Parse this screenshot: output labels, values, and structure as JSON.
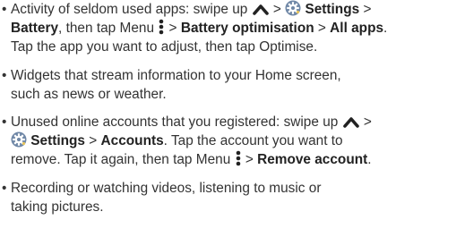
{
  "tips": [
    {
      "lines": [
        [
          "Activity of seldom used apps: swipe up ",
          {
            "icon": "chevron-up-icon"
          },
          " > ",
          {
            "icon": "settings-gear-icon"
          },
          " ",
          {
            "b": "Settings"
          },
          " >"
        ],
        [
          {
            "b": "Battery"
          },
          ", then tap Menu ",
          {
            "icon": "menu-dots-icon"
          },
          " > ",
          {
            "b": "Battery optimisation"
          },
          " > ",
          {
            "b": "All apps"
          },
          "."
        ],
        [
          "Tap the app you want to adjust, then tap Optimise."
        ]
      ]
    },
    {
      "lines": [
        [
          "Widgets that stream information to your Home screen,"
        ],
        [
          "such as news or weather."
        ]
      ]
    },
    {
      "lines": [
        [
          "Unused online accounts that you registered: swipe up ",
          {
            "icon": "chevron-up-icon"
          },
          " >"
        ],
        [
          {
            "icon": "settings-gear-icon"
          },
          " ",
          {
            "b": "Settings"
          },
          " > ",
          {
            "b": "Accounts"
          },
          ". Tap the account you want to"
        ],
        [
          "remove. Tap it again, then tap Menu ",
          {
            "icon": "menu-dots-icon"
          },
          " > ",
          {
            "b": "Remove account"
          },
          "."
        ]
      ]
    },
    {
      "lines": [
        [
          "Recording or watching videos, listening to music or"
        ],
        [
          "taking pictures."
        ]
      ]
    }
  ],
  "bullet_char": "•",
  "colors": {
    "text": "#333333",
    "icon": "#222222",
    "gear_fill": "#6f87a6",
    "gear_accent": "#e6c45c"
  }
}
